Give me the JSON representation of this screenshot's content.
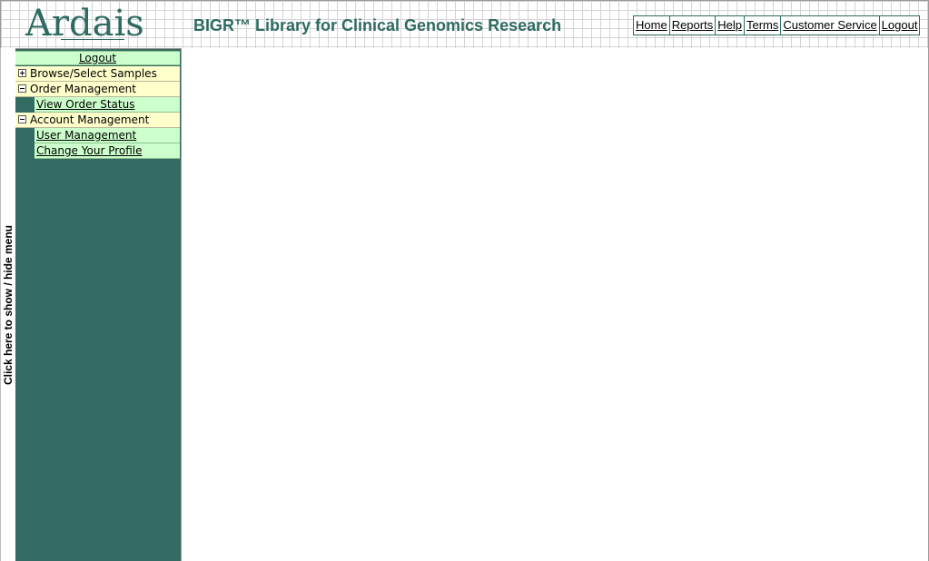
{
  "header": {
    "logo_text": "Ardais",
    "title": "BIGR™ Library for Clinical Genomics Research",
    "nav": [
      "Home",
      "Reports",
      "Help",
      "Terms",
      "Customer Service",
      "Logout"
    ]
  },
  "toggle": {
    "label": "Click here to show / hide menu"
  },
  "sidebar": {
    "logout_label": "Logout",
    "sections": [
      {
        "label": "Browse/Select Samples",
        "expanded": false,
        "items": []
      },
      {
        "label": "Order Management",
        "expanded": true,
        "items": [
          "View Order Status"
        ]
      },
      {
        "label": "Account Management",
        "expanded": true,
        "items": [
          "User Management",
          "Change Your Profile"
        ]
      }
    ]
  },
  "colors": {
    "brand": "#2e6b62",
    "sidebar_bg": "#336b63",
    "item_bg": "#ccffcc",
    "section_bg": "#ffffcc"
  }
}
